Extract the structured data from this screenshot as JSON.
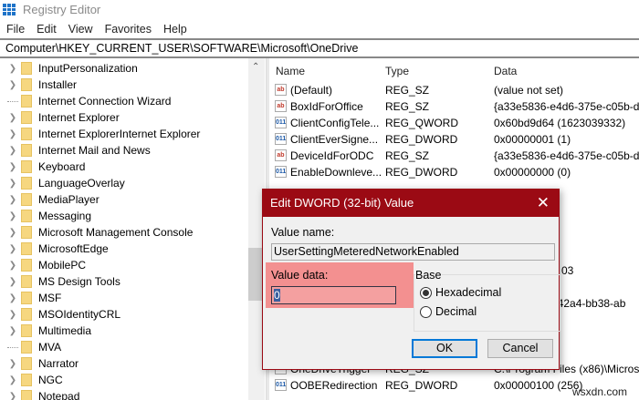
{
  "window": {
    "title": "Registry Editor"
  },
  "menu": [
    "File",
    "Edit",
    "View",
    "Favorites",
    "Help"
  ],
  "address": "Computer\\HKEY_CURRENT_USER\\SOFTWARE\\Microsoft\\OneDrive",
  "tree": [
    {
      "label": "InputPersonalization",
      "expandable": true
    },
    {
      "label": "Installer",
      "expandable": true
    },
    {
      "label": "Internet Connection Wizard",
      "expandable": false
    },
    {
      "label": "Internet Explorer",
      "expandable": true
    },
    {
      "label": "Internet ExplorerInternet Explorer",
      "expandable": true
    },
    {
      "label": "Internet Mail and News",
      "expandable": true
    },
    {
      "label": "Keyboard",
      "expandable": true
    },
    {
      "label": "LanguageOverlay",
      "expandable": true
    },
    {
      "label": "MediaPlayer",
      "expandable": true
    },
    {
      "label": "Messaging",
      "expandable": true
    },
    {
      "label": "Microsoft Management Console",
      "expandable": true
    },
    {
      "label": "MicrosoftEdge",
      "expandable": true
    },
    {
      "label": "MobilePC",
      "expandable": true
    },
    {
      "label": "MS Design Tools",
      "expandable": true
    },
    {
      "label": "MSF",
      "expandable": true
    },
    {
      "label": "MSOIdentityCRL",
      "expandable": true
    },
    {
      "label": "Multimedia",
      "expandable": true
    },
    {
      "label": "MVA",
      "expandable": false
    },
    {
      "label": "Narrator",
      "expandable": true
    },
    {
      "label": "NGC",
      "expandable": true
    },
    {
      "label": "Notepad",
      "expandable": true
    }
  ],
  "columns": {
    "name": "Name",
    "type": "Type",
    "data": "Data"
  },
  "values": [
    {
      "icon": "sz",
      "name": "(Default)",
      "type": "REG_SZ",
      "data": "(value not set)"
    },
    {
      "icon": "sz",
      "name": "BoxIdForOffice",
      "type": "REG_SZ",
      "data": "{a33e5836-e4d6-375e-c05b-d2"
    },
    {
      "icon": "bin",
      "name": "ClientConfigTele...",
      "type": "REG_QWORD",
      "data": "0x60bd9d64 (1623039332)"
    },
    {
      "icon": "bin",
      "name": "ClientEverSigne...",
      "type": "REG_DWORD",
      "data": "0x00000001 (1)"
    },
    {
      "icon": "sz",
      "name": "DeviceIdForODC",
      "type": "REG_SZ",
      "data": "{a33e5836-e4d6-375e-c05b-d2"
    },
    {
      "icon": "bin",
      "name": "EnableDownleve...",
      "type": "REG_DWORD",
      "data": "0x00000000 (0)"
    },
    {
      "icon": "",
      "name": "",
      "type": "",
      "data": ""
    },
    {
      "icon": "",
      "name": "",
      "type": "",
      "data": ""
    },
    {
      "icon": "",
      "name": "",
      "type": "",
      "data": ""
    },
    {
      "icon": "",
      "name": "",
      "type": "",
      "data": ""
    },
    {
      "icon": "",
      "name": "",
      "type": "",
      "data": ""
    },
    {
      "icon": "",
      "name": "",
      "type": "",
      "data": "03"
    },
    {
      "icon": "",
      "name": "",
      "type": "",
      "data": ""
    },
    {
      "icon": "",
      "name": "",
      "type": "",
      "data": "a-42a4-bb38-ab"
    },
    {
      "icon": "",
      "name": "",
      "type": "",
      "data": ""
    },
    {
      "icon": "",
      "name": "",
      "type": "",
      "data": ""
    },
    {
      "icon": "",
      "name": "",
      "type": "",
      "data": ""
    },
    {
      "icon": "sz",
      "name": "OneDriveTrigger",
      "type": "REG_SZ",
      "data": "C:\\Program Files (x86)\\Micros"
    },
    {
      "icon": "bin",
      "name": "OOBERedirection",
      "type": "REG_DWORD",
      "data": "0x00000100 (256)"
    }
  ],
  "dialog": {
    "title": "Edit DWORD (32-bit) Value",
    "value_name_label": "Value name:",
    "value_name": "UserSettingMeteredNetworkEnabled",
    "value_data_label": "Value data:",
    "value_data": "0",
    "base_label": "Base",
    "options": [
      "Hexadecimal",
      "Decimal"
    ],
    "selected": "Hexadecimal",
    "ok": "OK",
    "cancel": "Cancel",
    "highlight_color": "#f39090",
    "title_color": "#9b0a14"
  },
  "watermark": "wsxdn.com"
}
